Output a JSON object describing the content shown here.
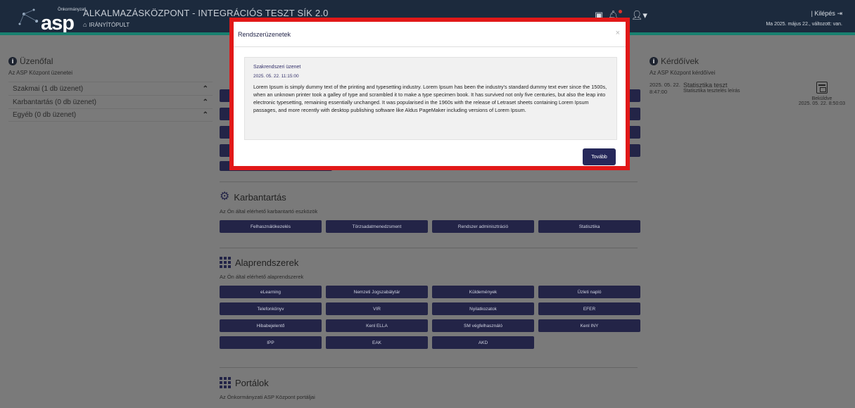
{
  "header": {
    "logo_text": "asp",
    "logo_small": "Önkormányzati",
    "app_title": "ALKALMAZÁSKÖZPONT - INTEGRÁCIÓS TESZT SÍK 2.0",
    "breadcrumb": "IRÁNYÍTÓPULT",
    "logout_label": "| Kilépés",
    "session_text": "Ma 2025. május 22., változott: van."
  },
  "left": {
    "title": "Üzenőfal",
    "subtitle": "Az ASP Központ üzenetei",
    "items": [
      {
        "label": "Szakmai (1 db üzenet)"
      },
      {
        "label": "Karbantartás (0 db üzenet)"
      },
      {
        "label": "Egyéb (0 db üzenet)"
      }
    ]
  },
  "center": {
    "maintenance": {
      "title": "Karbantartás",
      "subtitle": "Az Ön által elérhető karbantartó eszközök",
      "buttons": [
        "Felhasználókezelés",
        "Törzsadatmenedzsment",
        "Rendszer adminisztráció",
        "Statisztika"
      ]
    },
    "core": {
      "title": "Alaprendszerek",
      "subtitle": "Az Ön által elérhető alaprendszerek",
      "buttons": [
        "eLearning",
        "Nemzeti Jogszabálytár",
        "Küldemények",
        "Üzleti napló",
        "Telefonkönyv",
        "VIR",
        "Nyilatkozatok",
        "EFER",
        "Hibabejelentő",
        "Kenl ELLA",
        "SM végfelhasználó",
        "Kenl INY",
        "IPP",
        "EAK",
        "AKD"
      ]
    },
    "portals": {
      "title": "Portálok",
      "subtitle": "Az Önkormányzati ASP Központ portáljai"
    }
  },
  "right": {
    "title": "Kérdőívek",
    "subtitle": "Az ASP Központ kérdőívei",
    "survey": {
      "date": "2025. 05. 22. 8:47:00",
      "title": "Statisztika teszt",
      "description": "Statisztika tesztelés leírás",
      "send_label": "Beküldve",
      "send_date": "2025. 05. 22. 8:50:03"
    }
  },
  "modal": {
    "title": "Rendszerüzenetek",
    "close": "×",
    "message_title": "Szakrendszeri üzenet",
    "message_date": "2025. 05. 22. 11:15:00",
    "message_body": "Lorem Ipsum is simply dummy text of the printing and typesetting industry. Lorem Ipsum has been the industry's standard dummy text ever since the 1500s, when an unknown printer took a galley of type and scrambled it to make a type specimen book. It has survived not only five centuries, but also the leap into electronic typesetting, remaining essentially unchanged. It was popularised in the 1960s with the release of Letraset sheets containing Lorem Ipsum passages, and more recently with desktop publishing software like Aldus PageMaker including versions of Lorem Ipsum.",
    "next_label": "Tovább"
  },
  "colors": {
    "header_bg": "#1c2a3d",
    "header_accent": "#17806f",
    "button_bg": "#232447",
    "modal_border": "#e11818",
    "overlay_bg": "#7a7a7a"
  }
}
